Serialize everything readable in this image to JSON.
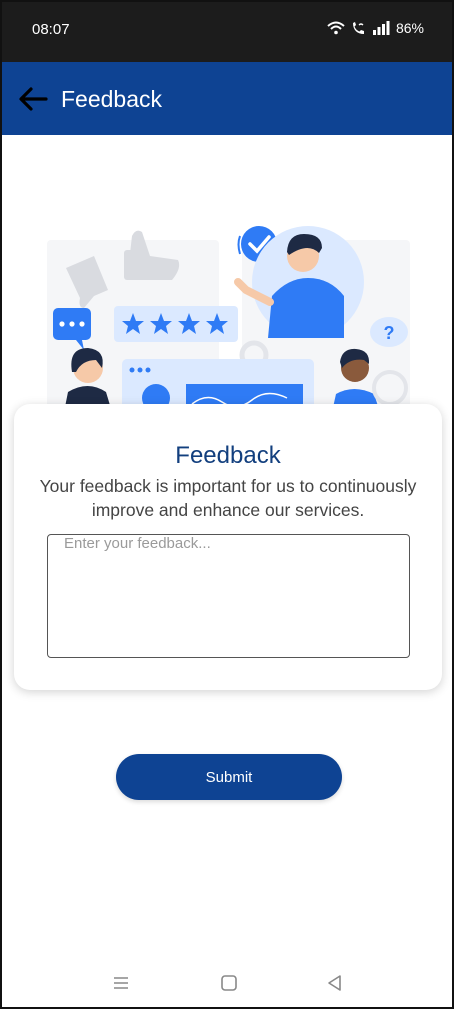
{
  "status_bar": {
    "time": "08:07",
    "battery": "86%",
    "icons": [
      "wifi-icon",
      "wifi-call-icon",
      "signal-icon"
    ]
  },
  "app_bar": {
    "title": "Feedback",
    "back_icon": "arrow-left-icon",
    "color": "#0e4393"
  },
  "card": {
    "title": "Feedback",
    "description": "Your feedback is important for us to continuously improve and enhance our services.",
    "input_value": "",
    "input_placeholder": "Enter your feedback..."
  },
  "actions": {
    "submit_label": "Submit"
  },
  "nav_bar": {
    "items": [
      "recent-apps-icon",
      "home-icon",
      "back-icon"
    ]
  },
  "colors": {
    "primary": "#0e4393",
    "accent_blue": "#2f7bf5",
    "illustration_light": "#dbe9ff"
  }
}
